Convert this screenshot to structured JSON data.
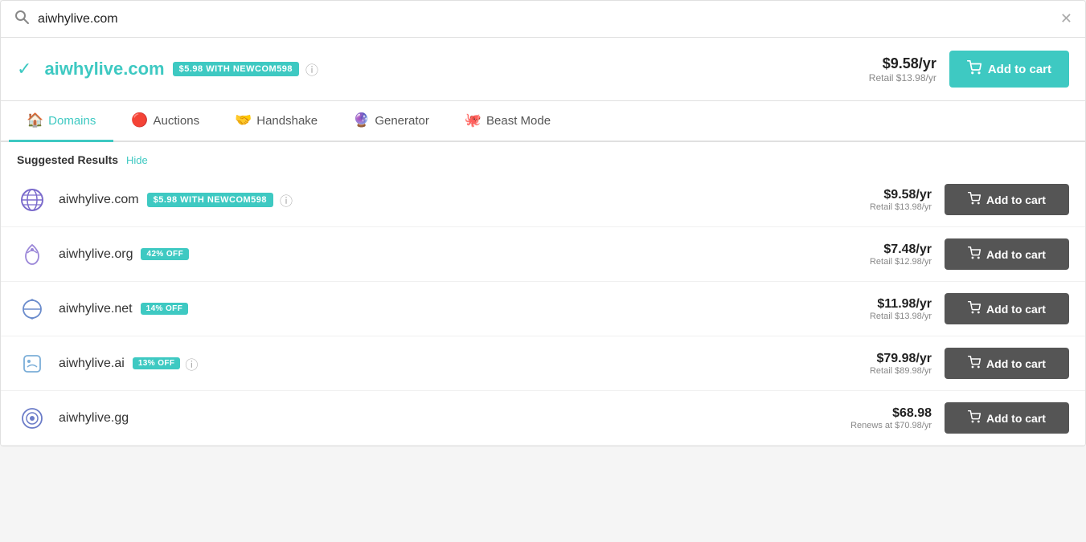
{
  "search": {
    "query": "aiwhylive.com",
    "placeholder": "aiwhylive.com",
    "clear_label": "✕"
  },
  "top_result": {
    "domain": "aiwhylive.com",
    "promo_badge": "$5.98 WITH NEWCOM598",
    "price_main": "$9.58/yr",
    "price_retail": "Retail $13.98/yr",
    "add_to_cart_label": "Add to cart"
  },
  "tabs": [
    {
      "id": "domains",
      "label": "Domains",
      "icon": "🏠",
      "active": true
    },
    {
      "id": "auctions",
      "label": "Auctions",
      "icon": "🔴",
      "active": false
    },
    {
      "id": "handshake",
      "label": "Handshake",
      "icon": "🤝",
      "active": false
    },
    {
      "id": "generator",
      "label": "Generator",
      "icon": "🔮",
      "active": false
    },
    {
      "id": "beast-mode",
      "label": "Beast Mode",
      "icon": "🐙",
      "active": false
    }
  ],
  "suggested": {
    "label": "Suggested Results",
    "hide_label": "Hide"
  },
  "domain_rows": [
    {
      "domain": "aiwhylive.com",
      "badge": "$5.98 WITH NEWCOM598",
      "badge_type": "promo",
      "has_info": true,
      "price_main": "$9.58/yr",
      "price_retail": "Retail $13.98/yr",
      "add_to_cart_label": "Add to cart",
      "icon_type": "globe"
    },
    {
      "domain": "aiwhylive.org",
      "badge": "42% OFF",
      "badge_type": "off",
      "has_info": false,
      "price_main": "$7.48/yr",
      "price_retail": "Retail $12.98/yr",
      "add_to_cart_label": "Add to cart",
      "icon_type": "leaf"
    },
    {
      "domain": "aiwhylive.net",
      "badge": "14% OFF",
      "badge_type": "off",
      "has_info": false,
      "price_main": "$11.98/yr",
      "price_retail": "Retail $13.98/yr",
      "add_to_cart_label": "Add to cart",
      "icon_type": "net"
    },
    {
      "domain": "aiwhylive.ai",
      "badge": "13% OFF",
      "badge_type": "off",
      "has_info": true,
      "price_main": "$79.98/yr",
      "price_retail": "Retail $89.98/yr",
      "add_to_cart_label": "Add to cart",
      "icon_type": "ai"
    },
    {
      "domain": "aiwhylive.gg",
      "badge": "",
      "badge_type": "",
      "has_info": false,
      "price_main": "$68.98",
      "price_retail": "Renews at $70.98/yr",
      "add_to_cart_label": "Add to cart",
      "icon_type": "gg"
    }
  ],
  "icons": {
    "search": "🔍",
    "cart": "🛒"
  }
}
